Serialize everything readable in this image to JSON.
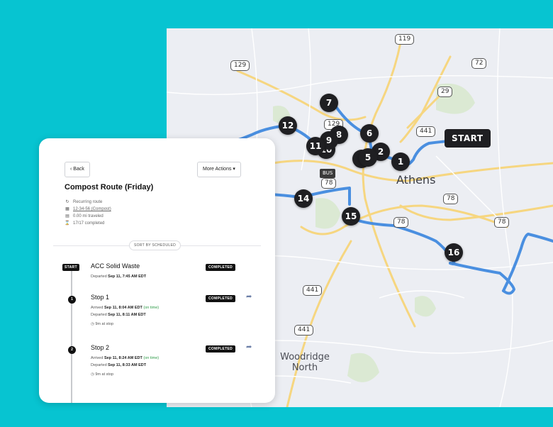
{
  "map": {
    "city": "Athens",
    "area": "Woodridge North",
    "start_marker": "START",
    "stop_markers": [
      "1",
      "2",
      "5",
      "6",
      "7",
      "8",
      "9",
      "10",
      "11",
      "12",
      "14",
      "15",
      "16"
    ],
    "shields": [
      "119",
      "129",
      "72",
      "29",
      "441",
      "129",
      "BUS",
      "78",
      "78",
      "78",
      "78",
      "441",
      "441"
    ],
    "colors": {
      "route": "#4a8fe0",
      "marker": "#1f1f22",
      "background": "#07c4d1"
    }
  },
  "panel": {
    "back_label": "Back",
    "more_actions_label": "More Actions",
    "title": "Compost Route (Friday)",
    "meta": {
      "recurring": "Recurring route",
      "vehicle": "12-34-56 (Compost)",
      "distance": "0.00 mi traveled",
      "progress": "17/17 completed"
    },
    "sort_label": "SORT BY SCHEDULED",
    "start_badge": "START",
    "stops": [
      {
        "name": "ACC Solid Waste",
        "status": "COMPLETED",
        "line1_prefix": "Departed",
        "line1_value": "Sep 11, 7:45 AM EDT"
      },
      {
        "number": "1",
        "name": "Stop 1",
        "status": "COMPLETED",
        "line1_prefix": "Arrived",
        "line1_value": "Sep 11, 8:04 AM EDT",
        "line1_note": "(on time)",
        "line2_prefix": "Departed",
        "line2_value": "Sep 11, 8:11 AM EDT",
        "duration": "9m at stop"
      },
      {
        "number": "2",
        "name": "Stop 2",
        "status": "COMPLETED",
        "line1_prefix": "Arrived",
        "line1_value": "Sep 11, 8:24 AM EDT",
        "line1_note": "(on time)",
        "line2_prefix": "Departed",
        "line2_value": "Sep 11, 8:33 AM EDT",
        "duration": "9m at stop"
      }
    ]
  }
}
